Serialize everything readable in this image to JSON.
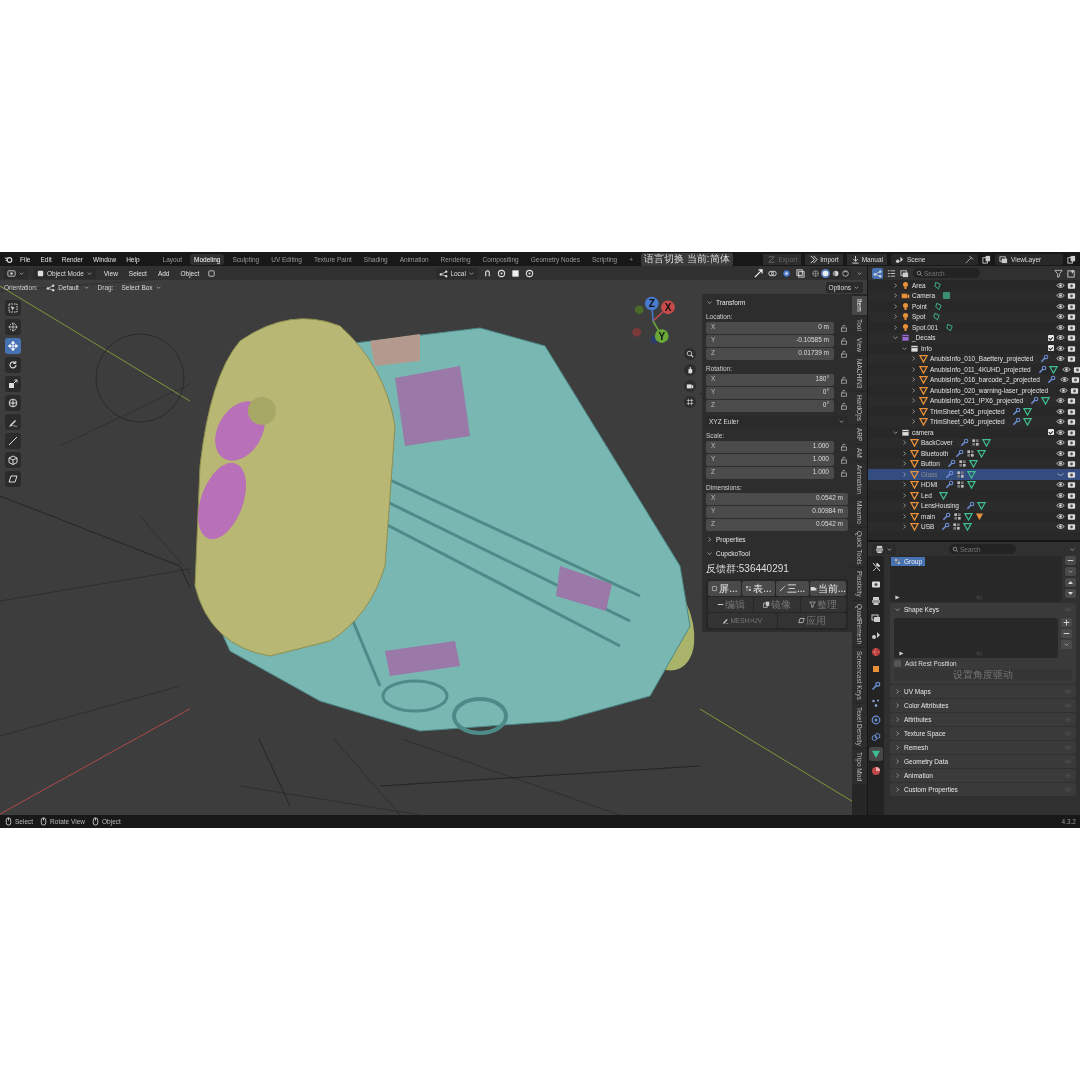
{
  "topbar": {
    "menu": [
      "File",
      "Edit",
      "Render",
      "Window",
      "Help"
    ],
    "workspaces": [
      {
        "label": "Layout",
        "selected": false
      },
      {
        "label": "Modeling",
        "selected": true
      },
      {
        "label": "Sculpting",
        "selected": false
      },
      {
        "label": "UV Editing",
        "selected": false
      },
      {
        "label": "Texture Paint",
        "selected": false
      },
      {
        "label": "Shading",
        "selected": false
      },
      {
        "label": "Animation",
        "selected": false
      },
      {
        "label": "Rendering",
        "selected": false
      },
      {
        "label": "Compositing",
        "selected": false
      },
      {
        "label": "Geometry Nodes",
        "selected": false
      },
      {
        "label": "Scripting",
        "selected": false
      }
    ],
    "add_workspace": "+",
    "language_button": "语言切换 当前:简体",
    "addon_buttons": [
      {
        "label": "Export",
        "disabled": true
      },
      {
        "label": "Import",
        "disabled": false
      },
      {
        "label": "Manual",
        "disabled": false
      }
    ],
    "scene": "Scene",
    "view_layer": "ViewLayer"
  },
  "viewport": {
    "mode": "Object Mode",
    "menus": [
      "View",
      "Select",
      "Add",
      "Object"
    ],
    "pivot": "Local",
    "orientation_label": "Orientation:",
    "orientation": "Default",
    "drag_label": "Drag:",
    "drag": "Select Box",
    "options": "Options",
    "shading_modes": [
      {
        "kind": "wireframe",
        "selected": false
      },
      {
        "kind": "solid",
        "selected": true
      },
      {
        "kind": "material",
        "selected": false
      },
      {
        "kind": "rendered",
        "selected": false
      }
    ],
    "tools": [
      {
        "kind": "select_box",
        "selected": false
      },
      {
        "kind": "cursor",
        "selected": false
      },
      {
        "kind": "move",
        "selected": true
      },
      {
        "kind": "rotate",
        "selected": false
      },
      {
        "kind": "scale",
        "selected": false
      },
      {
        "kind": "transform",
        "selected": false
      },
      {
        "kind": "annotate",
        "selected": false
      },
      {
        "kind": "measure",
        "selected": false
      },
      {
        "kind": "add_cube",
        "selected": false
      },
      {
        "kind": "shear",
        "selected": false
      }
    ],
    "gizmo_axes": [
      "X",
      "Y",
      "Z"
    ]
  },
  "n_panel": {
    "transform": {
      "title": "Transform",
      "expanded": true,
      "groups": [
        {
          "kind": "locked",
          "label": "Location:",
          "rows": [
            {
              "axis": "X",
              "value": "0 m"
            },
            {
              "axis": "Y",
              "value": "-0.10585 m"
            },
            {
              "axis": "Z",
              "value": "0.01739 m"
            }
          ]
        },
        {
          "kind": "locked",
          "label": "Rotation:",
          "rows": [
            {
              "axis": "X",
              "value": "180°"
            },
            {
              "axis": "Y",
              "value": "0°"
            },
            {
              "axis": "Z",
              "value": "0°"
            }
          ]
        },
        {
          "kind": "dropdown",
          "value": "XYZ Euler"
        },
        {
          "kind": "locked",
          "label": "Scale:",
          "rows": [
            {
              "axis": "X",
              "value": "1.000"
            },
            {
              "axis": "Y",
              "value": "1.000"
            },
            {
              "axis": "Z",
              "value": "1.000"
            }
          ]
        },
        {
          "kind": "plain",
          "label": "Dimensions:",
          "rows": [
            {
              "axis": "X",
              "value": "0.0542 m"
            },
            {
              "axis": "Y",
              "value": "0.00984 m"
            },
            {
              "axis": "Z",
              "value": "0.0542 m"
            }
          ]
        }
      ]
    },
    "properties": {
      "title": "Properties",
      "expanded": false
    },
    "cupcko": {
      "title": "CupckoTool",
      "expanded": true,
      "feedback": "反馈群:536440291",
      "button_rows": [
        [
          {
            "label": "屏...",
            "disabled": false
          },
          {
            "label": "表...",
            "disabled": false
          },
          {
            "label": "三...",
            "disabled": false
          },
          {
            "label": "当前...",
            "disabled": false
          }
        ],
        [
          {
            "label": "编辑",
            "disabled": true
          },
          {
            "label": "镜像",
            "disabled": true
          },
          {
            "label": "整理",
            "disabled": true
          }
        ],
        [
          {
            "label": "MESH>UV",
            "disabled": true
          },
          {
            "label": "应用",
            "disabled": true
          }
        ]
      ]
    },
    "tabs": [
      {
        "label": "Item",
        "selected": true
      },
      {
        "label": "Tool",
        "selected": false
      },
      {
        "label": "View",
        "selected": false
      },
      {
        "label": "MACHIN3",
        "selected": false
      },
      {
        "label": "HardOps",
        "selected": false
      },
      {
        "label": "ARP",
        "selected": false
      },
      {
        "label": "AM",
        "selected": false
      },
      {
        "label": "Animation",
        "selected": false
      },
      {
        "label": "Mixamo",
        "selected": false
      },
      {
        "label": "Quick Tools",
        "selected": false
      },
      {
        "label": "Plasticity",
        "selected": false
      },
      {
        "label": "QuadRemesh",
        "selected": false
      },
      {
        "label": "Screencast Keys",
        "selected": false
      },
      {
        "label": "Texel Density",
        "selected": false
      },
      {
        "label": "Tripo Mod",
        "selected": false
      }
    ]
  },
  "outliner": {
    "search_placeholder": "Search",
    "items": [
      {
        "name": "Area",
        "kind": "light",
        "expanded": false,
        "selected": false,
        "visible": true,
        "has_modifier": false,
        "has_material": false,
        "has_data": true
      },
      {
        "name": "Camera",
        "kind": "camera",
        "expanded": false,
        "selected": false,
        "visible": true,
        "has_modifier": false,
        "has_material": false,
        "has_data": true
      },
      {
        "name": "Point",
        "kind": "light",
        "expanded": false,
        "selected": false,
        "visible": true,
        "has_modifier": false,
        "has_material": false,
        "has_data": true
      },
      {
        "name": "Spot",
        "kind": "light",
        "expanded": false,
        "selected": false,
        "visible": true,
        "has_modifier": false,
        "has_material": false,
        "has_data": true
      },
      {
        "name": "Spot.001",
        "kind": "light",
        "expanded": false,
        "selected": false,
        "visible": true,
        "has_modifier": false,
        "has_material": false,
        "has_data": true
      },
      {
        "name": "_Decals",
        "kind": "collection",
        "color": "#9b6bd6",
        "checked": true,
        "expanded": true,
        "selected": false,
        "visible": true,
        "children": [
          {
            "name": "Info",
            "kind": "collection",
            "color": "#dddddd",
            "checked": true,
            "expanded": true,
            "selected": false,
            "visible": true,
            "children": [
              {
                "name": "AnubisInfo_010_Baettery_projected",
                "kind": "mesh",
                "expanded": false,
                "selected": false,
                "visible": true,
                "has_modifier": true,
                "has_material": false,
                "has_data": false
              },
              {
                "name": "AnubisInfo_011_4KUHD_projected",
                "kind": "mesh",
                "expanded": false,
                "selected": false,
                "visible": true,
                "has_modifier": true,
                "has_material": false,
                "has_data": true
              },
              {
                "name": "AnubisInfo_016_barcode_2_projected",
                "kind": "mesh",
                "expanded": false,
                "selected": false,
                "visible": true,
                "has_modifier": true,
                "has_material": false,
                "has_data": false
              },
              {
                "name": "AnubisInfo_020_warning-laser_projected",
                "kind": "mesh",
                "expanded": false,
                "selected": false,
                "visible": true,
                "has_modifier": false,
                "has_material": false,
                "has_data": false
              },
              {
                "name": "AnubisInfo_021_IPX6_projected",
                "kind": "mesh",
                "expanded": false,
                "selected": false,
                "visible": true,
                "has_modifier": true,
                "has_material": false,
                "has_data": true
              },
              {
                "name": "TrimSheet_045_projected",
                "kind": "mesh",
                "expanded": false,
                "selected": false,
                "visible": true,
                "has_modifier": true,
                "has_material": false,
                "has_data": true
              },
              {
                "name": "TrimSheet_046_projected",
                "kind": "mesh",
                "expanded": false,
                "selected": false,
                "visible": true,
                "has_modifier": true,
                "has_material": false,
                "has_data": true
              }
            ]
          }
        ]
      },
      {
        "name": "camera",
        "kind": "collection",
        "color": "#dddddd",
        "checked": true,
        "expanded": true,
        "selected": false,
        "visible": true,
        "children": [
          {
            "name": "BackCover",
            "kind": "mesh",
            "expanded": false,
            "selected": false,
            "visible": true,
            "has_modifier": true,
            "has_material": true,
            "has_data": true
          },
          {
            "name": "Bluetooth",
            "kind": "mesh",
            "expanded": false,
            "selected": false,
            "visible": true,
            "has_modifier": true,
            "has_material": true,
            "has_data": true
          },
          {
            "name": "Button",
            "kind": "mesh",
            "expanded": false,
            "selected": false,
            "visible": true,
            "has_modifier": true,
            "has_material": true,
            "has_data": true
          },
          {
            "name": "Glass",
            "kind": "mesh",
            "expanded": false,
            "selected": true,
            "visible": false,
            "has_modifier": true,
            "has_material": true,
            "has_data": true
          },
          {
            "name": "HDMI",
            "kind": "mesh",
            "expanded": false,
            "selected": false,
            "visible": true,
            "has_modifier": true,
            "has_material": true,
            "has_data": true
          },
          {
            "name": "Led",
            "kind": "mesh",
            "expanded": false,
            "selected": false,
            "visible": true,
            "has_modifier": false,
            "has_material": false,
            "has_data": true
          },
          {
            "name": "LensHousing",
            "kind": "mesh",
            "expanded": false,
            "selected": false,
            "visible": true,
            "has_modifier": true,
            "has_material": false,
            "has_data": true
          },
          {
            "name": "main",
            "kind": "mesh",
            "expanded": false,
            "selected": false,
            "visible": true,
            "has_modifier": true,
            "has_material": true,
            "has_data": true,
            "has_child_object": true
          },
          {
            "name": "USB",
            "kind": "mesh",
            "expanded": false,
            "selected": false,
            "visible": true,
            "has_modifier": true,
            "has_material": true,
            "has_data": true
          }
        ]
      }
    ]
  },
  "properties_editor": {
    "search_placeholder": "Search",
    "tabs": [
      {
        "kind": "tool",
        "selected": false
      },
      {
        "kind": "render",
        "selected": false
      },
      {
        "kind": "output",
        "selected": false
      },
      {
        "kind": "view_layer",
        "selected": false
      },
      {
        "kind": "scene",
        "selected": false
      },
      {
        "kind": "world",
        "selected": false
      },
      {
        "kind": "object",
        "selected": false
      },
      {
        "kind": "modifiers",
        "selected": false
      },
      {
        "kind": "particles",
        "selected": false
      },
      {
        "kind": "physics",
        "selected": false
      },
      {
        "kind": "constraints",
        "selected": false
      },
      {
        "kind": "data",
        "selected": true
      },
      {
        "kind": "material",
        "selected": false
      }
    ],
    "vertex_groups": [
      {
        "name": "Group",
        "selected": true
      }
    ],
    "panels": [
      {
        "title": "Shape Keys",
        "expanded": true,
        "rest_position": {
          "label": "Add Rest Position",
          "checked": false
        },
        "button": {
          "label": "设置角度驱动",
          "disabled": true
        }
      },
      {
        "title": "UV Maps",
        "expanded": false
      },
      {
        "title": "Color Attributes",
        "expanded": false
      },
      {
        "title": "Attributes",
        "expanded": false
      },
      {
        "title": "Texture Space",
        "expanded": false
      },
      {
        "title": "Remesh",
        "expanded": false
      },
      {
        "title": "Geometry Data",
        "expanded": false
      },
      {
        "title": "Animation",
        "expanded": false
      },
      {
        "title": "Custom Properties",
        "expanded": false
      }
    ]
  },
  "status_bar": {
    "hints": [
      "Select",
      "Rotate View",
      "Object"
    ],
    "version": "4.3.2"
  }
}
